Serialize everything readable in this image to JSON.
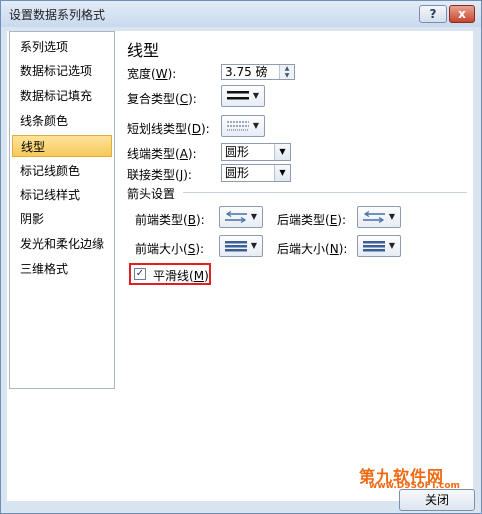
{
  "window": {
    "title": "设置数据系列格式",
    "help_label": "?",
    "close_label": "x"
  },
  "nav": {
    "items": [
      {
        "label": "系列选项"
      },
      {
        "label": "数据标记选项"
      },
      {
        "label": "数据标记填充"
      },
      {
        "label": "线条颜色"
      },
      {
        "label": "线型",
        "selected": true
      },
      {
        "label": "标记线颜色"
      },
      {
        "label": "标记线样式"
      },
      {
        "label": "阴影"
      },
      {
        "label": "发光和柔化边缘"
      },
      {
        "label": "三维格式"
      }
    ]
  },
  "panel": {
    "title": "线型",
    "width": {
      "label": "宽度",
      "key": "W",
      "value": "3.75 磅"
    },
    "compound_type": {
      "label": "复合类型",
      "key": "C"
    },
    "dash_type": {
      "label": "短划线类型",
      "key": "D"
    },
    "cap_type": {
      "label": "线端类型",
      "key": "A",
      "value": "圆形"
    },
    "join_type": {
      "label": "联接类型",
      "key": "J",
      "value": "圆形"
    },
    "arrow_settings": {
      "heading": "箭头设置",
      "begin_type": {
        "label": "前端类型",
        "key": "B"
      },
      "end_type": {
        "label": "后端类型",
        "key": "E"
      },
      "begin_size": {
        "label": "前端大小",
        "key": "S"
      },
      "end_size": {
        "label": "后端大小",
        "key": "N"
      }
    },
    "smoothed_line": {
      "label": "平滑线",
      "key": "M",
      "checked": true
    }
  },
  "footer": {
    "close_label": "关闭"
  },
  "watermark": {
    "top": "第九软件网",
    "bottom": "www.D9SOFT.com"
  },
  "colors": {
    "accent": "#e02020",
    "selection": "#f7c95a",
    "watermark": "#f06a14"
  }
}
